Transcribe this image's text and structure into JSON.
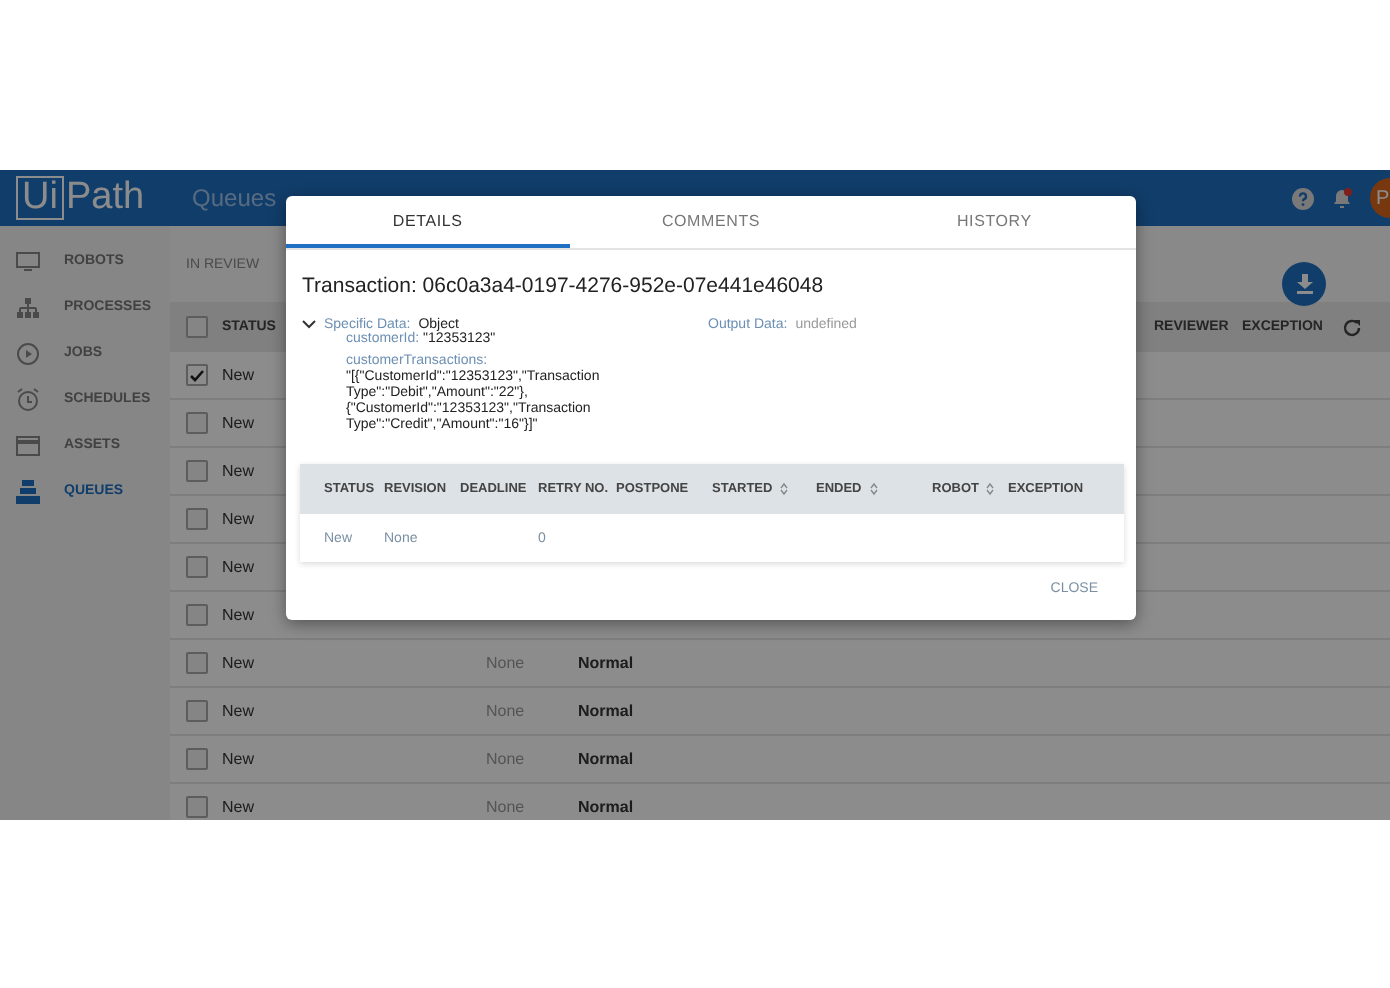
{
  "header": {
    "logo_box": "Ui",
    "logo_text": "Path",
    "breadcrumb": "Queues",
    "avatar": "P",
    "notifications_unread": true
  },
  "sidebar": {
    "items": [
      {
        "label": "ROBOTS",
        "selected": false
      },
      {
        "label": "PROCESSES",
        "selected": false
      },
      {
        "label": "JOBS",
        "selected": false
      },
      {
        "label": "SCHEDULES",
        "selected": false
      },
      {
        "label": "ASSETS",
        "selected": false
      },
      {
        "label": "QUEUES",
        "selected": true
      }
    ]
  },
  "tabs": [
    {
      "label": "IN REVIEW",
      "selected": false
    }
  ],
  "table": {
    "select_all_checked": false,
    "columns": [
      "STATUS",
      "REVIEWER",
      "EXCEPTION"
    ],
    "rows": [
      {
        "status": "New",
        "checked": true
      },
      {
        "status": "New",
        "checked": false
      },
      {
        "status": "New",
        "checked": false
      },
      {
        "status": "New",
        "checked": false
      },
      {
        "status": "New",
        "checked": false
      },
      {
        "status": "New",
        "checked": false
      },
      {
        "status": "New",
        "checked": false,
        "deadline": "None",
        "priority": "Normal"
      },
      {
        "status": "New",
        "checked": false,
        "deadline": "None",
        "priority": "Normal"
      },
      {
        "status": "New",
        "checked": false,
        "deadline": "None",
        "priority": "Normal"
      },
      {
        "status": "New",
        "checked": false,
        "deadline": "None",
        "priority": "Normal"
      }
    ]
  },
  "dialog": {
    "tabs": [
      {
        "label": "DETAILS",
        "selected": true
      },
      {
        "label": "COMMENTS",
        "selected": false
      },
      {
        "label": "HISTORY",
        "selected": false
      }
    ],
    "title": "Transaction: 06c0a3a4-0197-4276-952e-07e441e46048",
    "specific_data": {
      "label": "Specific Data:",
      "value": "Object",
      "expanded": true,
      "fields": [
        {
          "key": "customerId:",
          "value": "\"12353123\""
        },
        {
          "key": "customerTransactions:",
          "value": "\"[{\"CustomerId\":\"12353123\",\"Transaction Type\":\"Debit\",\"Amount\":\"22\"},{\"CustomerId\":\"12353123\",\"Transaction Type\":\"Credit\",\"Amount\":\"16\"}]\""
        }
      ]
    },
    "output_data": {
      "label": "Output Data:",
      "value": "undefined"
    },
    "history_table": {
      "columns": [
        {
          "label": "STATUS",
          "sortable": false
        },
        {
          "label": "REVISION",
          "sortable": false
        },
        {
          "label": "DEADLINE",
          "sortable": false
        },
        {
          "label": "RETRY NO.",
          "sortable": false
        },
        {
          "label": "POSTPONE",
          "sortable": false
        },
        {
          "label": "STARTED",
          "sortable": true
        },
        {
          "label": "ENDED",
          "sortable": true
        },
        {
          "label": "ROBOT",
          "sortable": true
        },
        {
          "label": "EXCEPTION",
          "sortable": false
        }
      ],
      "rows": [
        [
          "New",
          "None",
          "",
          "0",
          "",
          "",
          "",
          "",
          ""
        ]
      ]
    },
    "close_button": "CLOSE"
  }
}
